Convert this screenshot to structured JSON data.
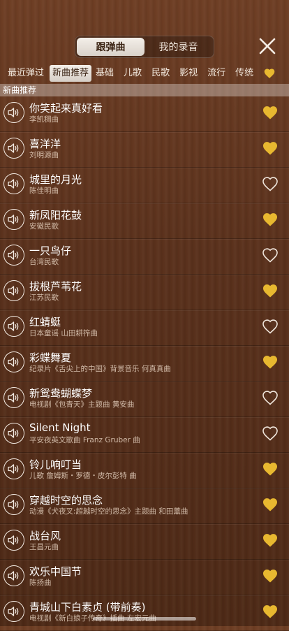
{
  "segment": {
    "items": [
      "跟弹曲",
      "我的录音"
    ],
    "active": 0
  },
  "tabs": [
    "最近弹过",
    "新曲推荐",
    "基础",
    "儿歌",
    "民歌",
    "影视",
    "流行",
    "传统"
  ],
  "active_tab": 1,
  "section_title": "新曲推荐",
  "colors": {
    "heart_filled": "#e8b830",
    "heart_outline": "#f0e6dc",
    "wood": "#5a311c"
  },
  "songs": [
    {
      "title": "你笑起来真好看",
      "subtitle": "李凯稠曲",
      "favorite": true
    },
    {
      "title": "喜洋洋",
      "subtitle": "刘明源曲",
      "favorite": true
    },
    {
      "title": "城里的月光",
      "subtitle": "陈佳明曲",
      "favorite": false
    },
    {
      "title": "新凤阳花鼓",
      "subtitle": "安徽民歌",
      "favorite": true
    },
    {
      "title": "一只鸟仔",
      "subtitle": "台湾民歌",
      "favorite": false
    },
    {
      "title": "拔根芦苇花",
      "subtitle": "江苏民歌",
      "favorite": true
    },
    {
      "title": "红蜻蜓",
      "subtitle": "日本童谣 山田耕筰曲",
      "favorite": false
    },
    {
      "title": "彩蝶舞夏",
      "subtitle": "纪录片《舌尖上的中国》背景音乐 何真真曲",
      "favorite": true
    },
    {
      "title": "新鸳鸯蝴蝶梦",
      "subtitle": "电视剧《包青天》主题曲 黄安曲",
      "favorite": false
    },
    {
      "title": "Silent Night",
      "subtitle": "平安夜英文歌曲  Franz Gruber 曲",
      "favorite": false
    },
    {
      "title": "铃儿响叮当",
      "subtitle": "儿歌 詹姆斯・罗德・皮尔彭特 曲",
      "favorite": true
    },
    {
      "title": "穿越时空的思念",
      "subtitle": "动漫《犬夜叉:超越时空的思念》主题曲 和田薰曲",
      "favorite": true
    },
    {
      "title": "战台风",
      "subtitle": "王昌元曲",
      "favorite": true
    },
    {
      "title": "欢乐中国节",
      "subtitle": "陈扬曲",
      "favorite": true
    },
    {
      "title": "青城山下白素贞 (带前奏)",
      "subtitle": "电视剧《新白娘子传奇》插曲 左宏元曲",
      "favorite": true
    }
  ]
}
